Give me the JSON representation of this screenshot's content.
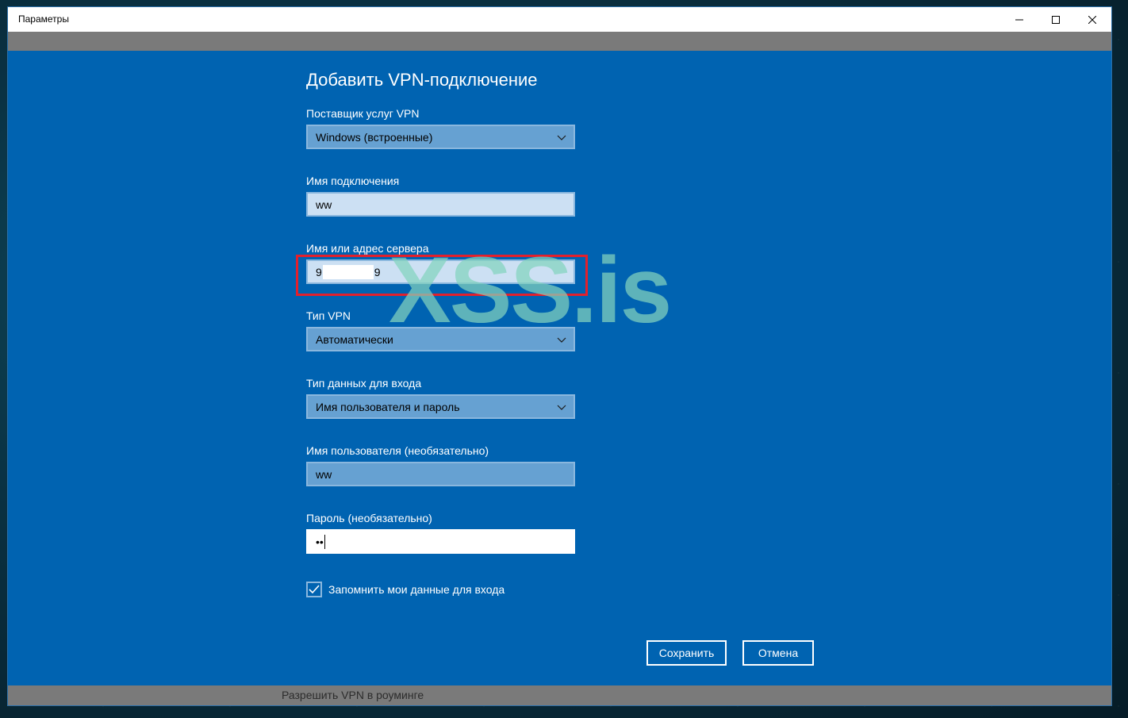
{
  "window": {
    "title": "Параметры"
  },
  "titlebar_buttons": {
    "minimize_icon": "minimize-icon",
    "maximize_icon": "maximize-icon",
    "close_icon": "close-icon"
  },
  "dialog": {
    "title": "Добавить VPN-подключение",
    "provider": {
      "label": "Поставщик услуг VPN",
      "value": "Windows (встроенные)"
    },
    "connection_name": {
      "label": "Имя подключения",
      "value": "ww"
    },
    "server": {
      "label": "Имя или адрес сервера",
      "value_prefix": "9",
      "value_suffix": "9"
    },
    "vpn_type": {
      "label": "Тип VPN",
      "value": "Автоматически"
    },
    "signin_type": {
      "label": "Тип данных для входа",
      "value": "Имя пользователя и пароль"
    },
    "username": {
      "label": "Имя пользователя (необязательно)",
      "value": "ww"
    },
    "password": {
      "label": "Пароль (необязательно)",
      "value": "••"
    },
    "remember": {
      "label": "Запомнить мои данные для входа",
      "checked": true
    },
    "save_button": "Сохранить",
    "cancel_button": "Отмена"
  },
  "background_text": {
    "roaming": "Разрешить VPN в роуминге"
  },
  "watermark": "XSS.is",
  "colors": {
    "accent": "#0063b1",
    "field_select": "#66a1d2",
    "field_light": "#cce0f3",
    "highlight": "#e2202c"
  }
}
